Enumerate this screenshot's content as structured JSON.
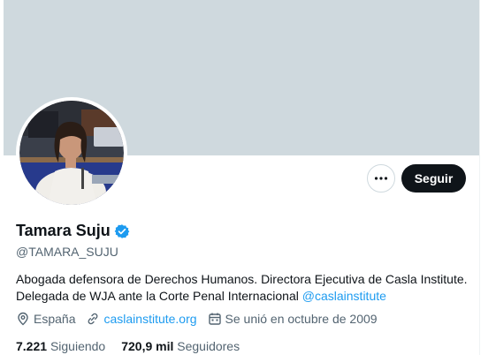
{
  "profile": {
    "name": "Tamara Suju",
    "handle": "@TAMARA_SUJU",
    "bio_text": "Abogada defensora de Derechos Humanos. Directora Ejecutiva de Casla Institute. Delegada de WJA ante la Corte Penal Internacional ",
    "bio_mention": "@caslainstitute",
    "location": "España",
    "website": "caslainstitute.org",
    "joined": "Se unió en octubre de 2009",
    "following_count": "7.221",
    "following_label": "Siguiendo",
    "followers_count": "720,9 mil",
    "followers_label": "Seguidores"
  },
  "actions": {
    "follow_label": "Seguir"
  },
  "colors": {
    "banner": "#cfd9de",
    "accent": "#1d9bf0",
    "follow_button": "#0f1419",
    "secondary_text": "#536471"
  },
  "icons": {
    "more": "more-icon",
    "verified": "verified-badge-icon",
    "location": "location-pin-icon",
    "link": "link-icon",
    "calendar": "calendar-icon"
  }
}
